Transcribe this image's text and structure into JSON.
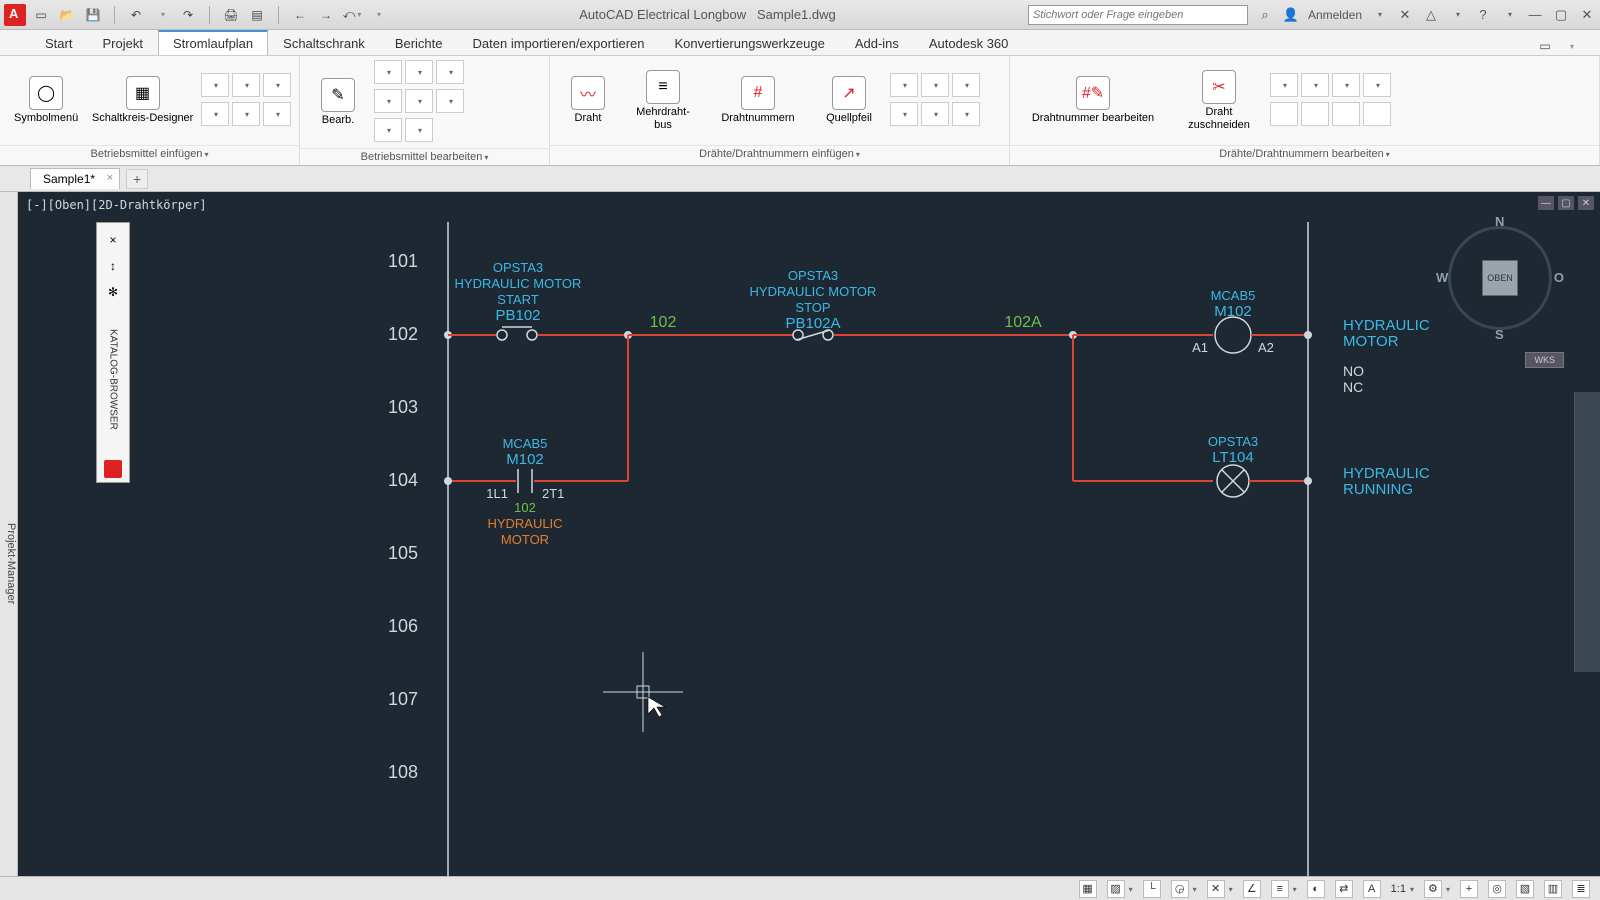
{
  "app": {
    "title_left": "AutoCAD Electrical Longbow",
    "title_doc": "Sample1.dwg",
    "search_placeholder": "Stichwort oder Frage eingeben",
    "signin": "Anmelden"
  },
  "tabs": {
    "items": [
      "Start",
      "Projekt",
      "Stromlaufplan",
      "Schaltschrank",
      "Berichte",
      "Daten importieren/exportieren",
      "Konvertierungswerkzeuge",
      "Add-ins",
      "Autodesk 360"
    ],
    "active": 2
  },
  "ribbon": {
    "panel1": {
      "title": "Betriebsmittel einfügen",
      "btn1": "Symbolmenü",
      "btn2": "Schaltkreis-Designer"
    },
    "panel2": {
      "title": "Betriebsmittel bearbeiten",
      "btn1": "Bearb."
    },
    "panel3": {
      "title": "Drähte/Drahtnummern einfügen",
      "b1": "Draht",
      "b2": "Mehrdraht-\nbus",
      "b3": "Drahtnummern",
      "b4": "Quellpfeil"
    },
    "panel4": {
      "title": "Drähte/Drahtnummern bearbeiten",
      "b1": "Drahtnummer bearbeiten",
      "b2": "Draht\nzuschneiden"
    }
  },
  "doctab": {
    "name": "Sample1*"
  },
  "viewport": {
    "label": "[-][Oben][2D-Drahtkörper]"
  },
  "palette": {
    "title": "KATALOG-BROWSER"
  },
  "leftdock": {
    "title": "Projekt-Manager"
  },
  "viewcube": {
    "face": "OBEN",
    "n": "N",
    "s": "S",
    "e": "O",
    "w": "W",
    "wks": "WKS"
  },
  "status": {
    "scale": "1:1"
  },
  "schematic": {
    "rows": [
      "101",
      "102",
      "103",
      "104",
      "105",
      "106",
      "107",
      "108"
    ],
    "pb102": {
      "loc": "OPSTA3",
      "desc": "HYDRAULIC  MOTOR",
      "func": "START",
      "tag": "PB102"
    },
    "pb102a": {
      "loc": "OPSTA3",
      "desc": "HYDRAULIC  MOTOR",
      "func": "STOP",
      "tag": "PB102A"
    },
    "m102coil": {
      "loc": "MCAB5",
      "tag": "M102",
      "t1": "A1",
      "t2": "A2"
    },
    "m102contact": {
      "loc": "MCAB5",
      "tag": "M102",
      "t1": "1L1",
      "t2": "2T1",
      "wn": "102",
      "desc1": "HYDRAULIC",
      "desc2": "MOTOR"
    },
    "lt104": {
      "loc": "OPSTA3",
      "tag": "LT104"
    },
    "wn102": "102",
    "wn102a": "102A",
    "xref1": "HYDRAULIC",
    "xref1b": "MOTOR",
    "xref1c": "NO",
    "xref1d": "NC",
    "xref2": "HYDRAULIC",
    "xref2b": "RUNNING"
  }
}
